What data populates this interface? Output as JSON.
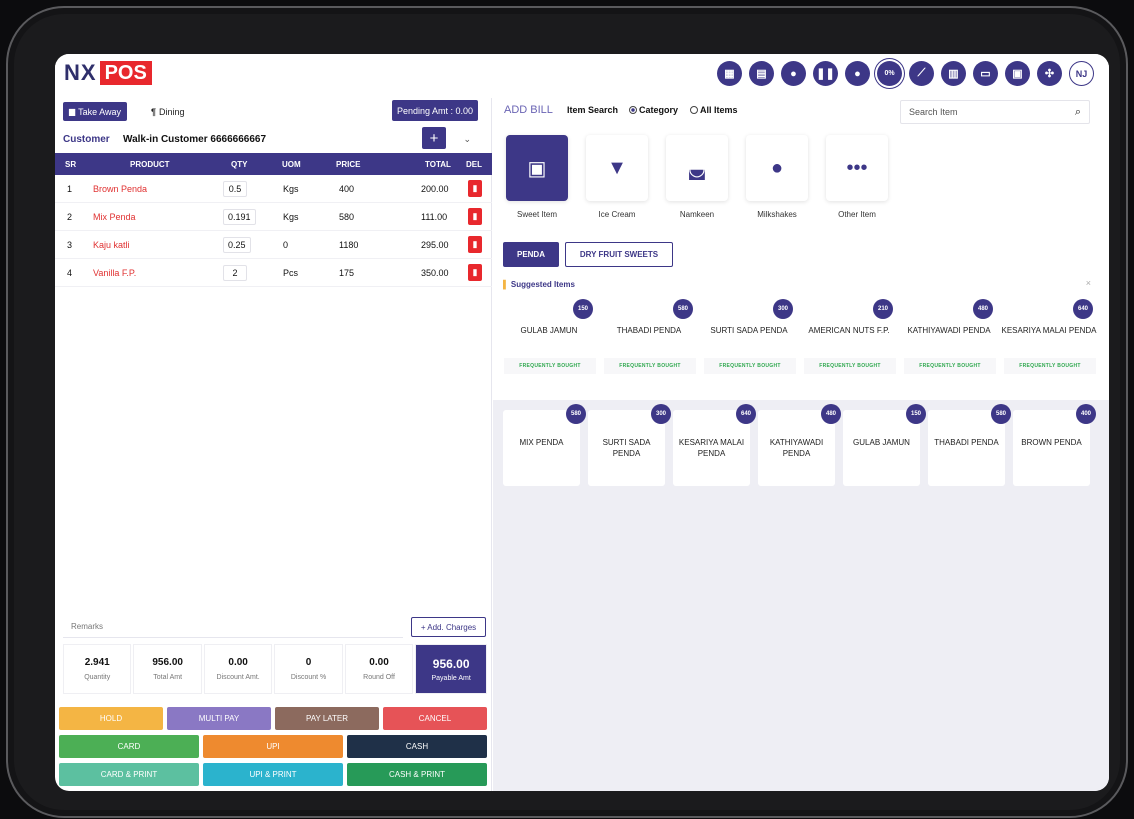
{
  "brand": {
    "nx": "NX",
    "pos": "POS"
  },
  "header_icons": [
    {
      "name": "calendar-icon",
      "glyph": "▦"
    },
    {
      "name": "document-icon",
      "glyph": "▤"
    },
    {
      "name": "user-icon",
      "glyph": "●"
    },
    {
      "name": "pause-icon",
      "glyph": "❚❚"
    },
    {
      "name": "bulb-icon",
      "glyph": "●"
    },
    {
      "name": "discount-icon",
      "glyph": "0%"
    },
    {
      "name": "chart-icon",
      "glyph": "⟋"
    },
    {
      "name": "calculator-icon",
      "glyph": "▥"
    },
    {
      "name": "monitor-icon",
      "glyph": "▭"
    },
    {
      "name": "id-card-icon",
      "glyph": "▣"
    },
    {
      "name": "fullscreen-icon",
      "glyph": "✣"
    },
    {
      "name": "user-avatar",
      "glyph": "NJ"
    }
  ],
  "order": {
    "take_away": "Take Away",
    "dining": "Dining",
    "pending_amt": "Pending Amt : 0.00",
    "customer_label": "Customer",
    "customer_value": "Walk-in Customer 6666666667",
    "add_symbol": "+"
  },
  "table": {
    "headers": {
      "sr": "SR",
      "product": "PRODUCT",
      "qty": "QTY",
      "uom": "UOM",
      "price": "PRICE",
      "total": "TOTAL",
      "del": "DEL"
    },
    "rows": [
      {
        "sr": "1",
        "product": "Brown Penda",
        "qty": "0.5",
        "uom": "Kgs",
        "price": "400",
        "total": "200.00"
      },
      {
        "sr": "2",
        "product": "Mix Penda",
        "qty": "0.191",
        "uom": "Kgs",
        "price": "580",
        "total": "111.00"
      },
      {
        "sr": "3",
        "product": "Kaju katli",
        "qty": "0.25",
        "uom": "0",
        "price": "1180",
        "total": "295.00"
      },
      {
        "sr": "4",
        "product": "Vanilla F.P.",
        "qty": "2",
        "uom": "Pcs",
        "price": "175",
        "total": "350.00"
      }
    ]
  },
  "remarks_placeholder": "Remarks",
  "add_charges": "+ Add. Charges",
  "totals": [
    {
      "value": "2.941",
      "label": "Quantity"
    },
    {
      "value": "956.00",
      "label": "Total Amt"
    },
    {
      "value": "0.00",
      "label": "Discount Amt."
    },
    {
      "value": "0",
      "label": "Discount %"
    },
    {
      "value": "0.00",
      "label": "Round Off"
    },
    {
      "value": "956.00",
      "label": "Payable Amt"
    }
  ],
  "actions": {
    "hold": "HOLD",
    "multi_pay": "MULTI PAY",
    "pay_later": "PAY LATER",
    "cancel": "CANCEL",
    "card": "CARD",
    "upi": "UPI",
    "cash": "CASH",
    "card_print": "CARD & PRINT",
    "upi_print": "UPI & PRINT",
    "cash_print": "CASH & PRINT"
  },
  "colors": {
    "primary": "#3d3787",
    "hold": "#f4b544",
    "multi_pay": "#8a78c4",
    "pay_later": "#8c6a5e",
    "cancel": "#e65357",
    "card": "#4caf55",
    "upi": "#ee8a2f",
    "cash": "#1f3048",
    "card_print": "#5cc0a0",
    "upi_print": "#2bb3cd",
    "cash_print": "#279a58"
  },
  "right": {
    "add_bill": "ADD BILL",
    "item_search": "Item Search",
    "category": "Category",
    "all_items": "All Items",
    "search_placeholder": "Search Item"
  },
  "categories": [
    {
      "label": "Sweet Item",
      "icon": "box-icon",
      "glyph": "▣"
    },
    {
      "label": "Ice Cream",
      "icon": "ice-cream-icon",
      "glyph": "▼"
    },
    {
      "label": "Namkeen",
      "icon": "bag-icon",
      "glyph": "◛"
    },
    {
      "label": "Milkshakes",
      "icon": "circle-icon",
      "glyph": "●"
    },
    {
      "label": "Other Item",
      "icon": "more-icon",
      "glyph": "•••"
    }
  ],
  "tabs": {
    "penda": "PENDA",
    "dry_fruit": "DRY FRUIT SWEETS"
  },
  "suggested": {
    "title": "Suggested Items",
    "close": "×",
    "badge": "FREQUENTLY BOUGHT",
    "items": [
      {
        "name": "GULAB JAMUN",
        "price": "150"
      },
      {
        "name": "THABADI PENDA",
        "price": "580"
      },
      {
        "name": "SURTI SADA PENDA",
        "price": "300"
      },
      {
        "name": "AMERICAN NUTS F.P.",
        "price": "210"
      },
      {
        "name": "KATHIYAWADI PENDA",
        "price": "480"
      },
      {
        "name": "KESARIYA MALAI PENDA",
        "price": "640"
      }
    ]
  },
  "grid_items": [
    {
      "name": "MIX PENDA",
      "price": "580"
    },
    {
      "name": "SURTI SADA PENDA",
      "price": "300"
    },
    {
      "name": "KESARIYA MALAI PENDA",
      "price": "640"
    },
    {
      "name": "KATHIYAWADI PENDA",
      "price": "480"
    },
    {
      "name": "GULAB JAMUN",
      "price": "150"
    },
    {
      "name": "THABADI PENDA",
      "price": "580"
    },
    {
      "name": "BROWN PENDA",
      "price": "400"
    }
  ]
}
